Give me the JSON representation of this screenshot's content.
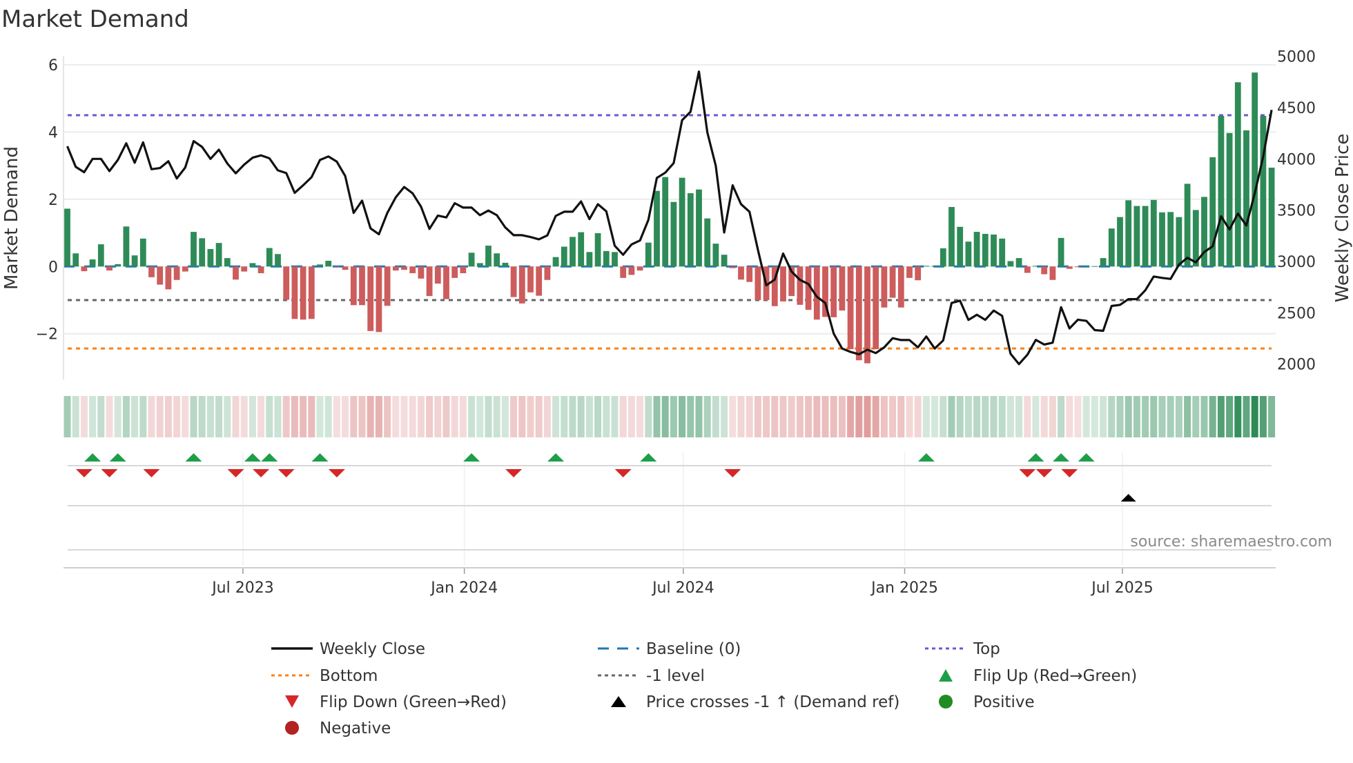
{
  "chart_data": {
    "type": "bar",
    "title": "Market Demand",
    "ylabel": "Market Demand",
    "y2label": "Weekly Close Price",
    "source": "source: sharemaestro.com",
    "interval": "weekly",
    "start_date": "2023-02-05",
    "ylim": [
      -3.36,
      6.26
    ],
    "y2lim": [
      1850,
      5002
    ],
    "yticks": [
      {
        "v": -2,
        "label": "−2"
      },
      {
        "v": 0,
        "label": "0"
      },
      {
        "v": 2,
        "label": "2"
      },
      {
        "v": 4,
        "label": "4"
      },
      {
        "v": 6,
        "label": "6"
      }
    ],
    "y2ticks": [
      {
        "v": 2000,
        "label": "2000"
      },
      {
        "v": 2500,
        "label": "2500"
      },
      {
        "v": 3000,
        "label": "3000"
      },
      {
        "v": 3500,
        "label": "3500"
      },
      {
        "v": 4000,
        "label": "4000"
      },
      {
        "v": 4500,
        "label": "4500"
      },
      {
        "v": 5000,
        "label": "5000"
      }
    ],
    "xticks": [
      {
        "date": "2023-07-01",
        "label": "Jul 2023"
      },
      {
        "date": "2024-01-01",
        "label": "Jan 2024"
      },
      {
        "date": "2024-07-01",
        "label": "Jul 2024"
      },
      {
        "date": "2025-01-01",
        "label": "Jan 2025"
      },
      {
        "date": "2025-07-01",
        "label": "Jul 2025"
      }
    ],
    "levels": {
      "top": 4.5,
      "bottom": -2.44,
      "minus_one": -1,
      "baseline": 0
    },
    "colors": {
      "positive": "#2e8b57",
      "negative": "#cd5c5c",
      "price": "#111111",
      "top": "#6a5acd",
      "bottom": "#ff7f0e",
      "minus_one": "#666666",
      "baseline": "#1f77b4",
      "flip_up": "#1e9e48",
      "flip_down": "#d62728",
      "cross": "#000000",
      "positive_dot": "#228b22",
      "negative_dot": "#b22222"
    },
    "demand": [
      1.72,
      0.39,
      -0.14,
      0.21,
      0.66,
      -0.12,
      0.07,
      1.19,
      0.33,
      0.83,
      -0.32,
      -0.54,
      -0.68,
      -0.4,
      -0.15,
      1.03,
      0.84,
      0.52,
      0.7,
      0.25,
      -0.39,
      -0.15,
      0.1,
      -0.2,
      0.55,
      0.37,
      -0.99,
      -1.56,
      -1.58,
      -1.56,
      0.06,
      0.17,
      -0.02,
      -0.1,
      -1.15,
      -1.15,
      -1.92,
      -1.95,
      -1.17,
      -0.12,
      -0.1,
      -0.2,
      -0.36,
      -0.88,
      -0.51,
      -0.97,
      -0.34,
      -0.2,
      0.41,
      0.1,
      0.62,
      0.39,
      0.11,
      -0.91,
      -1.1,
      -0.77,
      -0.87,
      -0.4,
      0.28,
      0.59,
      0.88,
      1.02,
      0.43,
      0.99,
      0.46,
      0.43,
      -0.34,
      -0.25,
      -0.12,
      0.71,
      2.25,
      2.66,
      1.92,
      2.64,
      2.18,
      2.29,
      1.43,
      0.68,
      0.35,
      -0.05,
      -0.39,
      -0.46,
      -1.0,
      -1.0,
      -1.18,
      -1.04,
      -0.88,
      -1.14,
      -1.29,
      -1.58,
      -1.5,
      -1.51,
      -1.31,
      -2.46,
      -2.79,
      -2.88,
      -2.46,
      -1.22,
      -0.93,
      -1.22,
      -0.34,
      -0.41,
      0.02,
      0.02,
      0.54,
      1.77,
      1.18,
      0.74,
      1.03,
      0.97,
      0.95,
      0.83,
      0.16,
      0.25,
      -0.19,
      0.02,
      -0.23,
      -0.4,
      0.85,
      -0.07,
      -0.02,
      0.02,
      0.01,
      0.25,
      1.13,
      1.47,
      1.97,
      1.8,
      1.8,
      1.98,
      1.61,
      1.62,
      1.47,
      2.46,
      1.68,
      2.07,
      3.25,
      4.48,
      3.97,
      5.48,
      4.05,
      5.77,
      4.48,
      2.94
    ],
    "weekly_close": [
      4123,
      3922,
      3870,
      4000,
      4000,
      3881,
      3989,
      4152,
      3962,
      4161,
      3899,
      3910,
      3977,
      3809,
      3915,
      4173,
      4117,
      4000,
      4090,
      3955,
      3859,
      3944,
      4011,
      4034,
      4005,
      3888,
      3861,
      3668,
      3742,
      3821,
      3989,
      4023,
      3973,
      3832,
      3473,
      3592,
      3323,
      3265,
      3473,
      3625,
      3726,
      3664,
      3534,
      3317,
      3447,
      3429,
      3568,
      3525,
      3525,
      3451,
      3496,
      3451,
      3332,
      3256,
      3256,
      3238,
      3216,
      3254,
      3444,
      3485,
      3485,
      3585,
      3413,
      3558,
      3489,
      3153,
      3065,
      3166,
      3204,
      3406,
      3814,
      3865,
      3959,
      4376,
      4459,
      4851,
      4257,
      3932,
      3282,
      3742,
      3558,
      3485,
      3115,
      2767,
      2823,
      3077,
      2902,
      2820,
      2780,
      2656,
      2595,
      2297,
      2151,
      2118,
      2095,
      2140,
      2107,
      2163,
      2252,
      2234,
      2234,
      2163,
      2268,
      2151,
      2230,
      2595,
      2618,
      2430,
      2481,
      2431,
      2521,
      2470,
      2100,
      1999,
      2091,
      2235,
      2190,
      2208,
      2555,
      2347,
      2432,
      2421,
      2331,
      2324,
      2566,
      2577,
      2633,
      2633,
      2719,
      2853,
      2840,
      2830,
      2969,
      3036,
      2991,
      3092,
      3148,
      3440,
      3312,
      3467,
      3350,
      3664,
      4022,
      4477
    ],
    "price_crosses_up_week_index": [
      126
    ],
    "legend": [
      {
        "key": "price",
        "label": "Weekly Close",
        "kind": "solid"
      },
      {
        "key": "baseline",
        "label": "Baseline (0)",
        "kind": "dash"
      },
      {
        "key": "top",
        "label": "Top",
        "kind": "dot"
      },
      {
        "key": "bottom",
        "label": "Bottom",
        "kind": "dot"
      },
      {
        "key": "minus_one",
        "label": "-1 level",
        "kind": "dot"
      },
      {
        "key": "flip_up",
        "label": "Flip Up (Red→Green)",
        "kind": "tri-up"
      },
      {
        "key": "flip_down",
        "label": "Flip Down (Green→Red)",
        "kind": "tri-down"
      },
      {
        "key": "cross",
        "label": "Price crosses -1 ↑ (Demand ref)",
        "kind": "tri-up-small"
      },
      {
        "key": "positive_dot",
        "label": "Positive",
        "kind": "dot-marker"
      },
      {
        "key": "negative_dot",
        "label": "Negative",
        "kind": "dot-marker"
      }
    ]
  }
}
